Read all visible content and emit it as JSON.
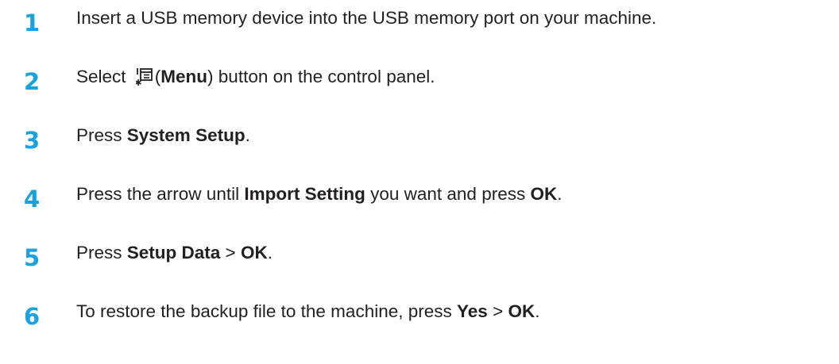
{
  "steps": [
    {
      "number": "1",
      "text": "Insert a USB memory device into the USB memory port on your machine."
    },
    {
      "number": "2",
      "pre": "Select ",
      "icon": "menu-icon",
      "paren_open": "(",
      "bold1": "Menu",
      "rest": ") button on the control panel."
    },
    {
      "number": "3",
      "pre": "Press ",
      "bold1": "System Setup",
      "post": "."
    },
    {
      "number": "4",
      "pre": "Press the arrow until ",
      "bold1": "Import Setting",
      "mid": " you want and press ",
      "bold2": "OK",
      "post": "."
    },
    {
      "number": "5",
      "pre": "Press ",
      "bold1": "Setup Data",
      "mid": " > ",
      "bold2": "OK",
      "post": "."
    },
    {
      "number": "6",
      "pre": "To restore the backup file to the machine, press ",
      "bold1": "Yes",
      "mid": " > ",
      "bold2": "OK",
      "post": "."
    }
  ],
  "colors": {
    "step_number": "#1aa2dc",
    "text": "#231f20"
  }
}
